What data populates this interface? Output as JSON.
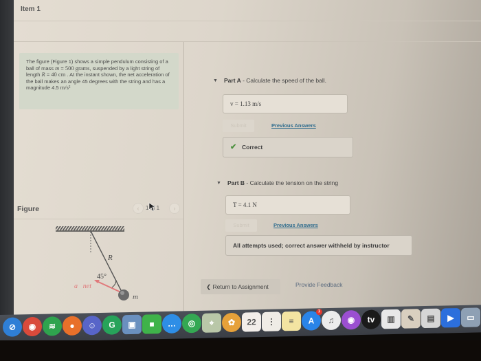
{
  "header": {
    "item_title": "Item 1"
  },
  "problem": {
    "text_parts": [
      "The figure (Figure 1) shows a simple pendulum consisting of a ball of mass ",
      "m",
      " = ",
      "500 grams",
      ", suspended by a light string of length ",
      "R",
      " = ",
      "40 cm",
      " . At the instant shown, the net acceleration of the ball makes an angle 45 degrees with the string and has a magnitude 4.5 ",
      "m/s²"
    ]
  },
  "figure": {
    "label": "Figure",
    "pager": {
      "prev": "‹",
      "count": "1 of 1",
      "next": "›"
    },
    "labels": {
      "length": "R",
      "angle": "45°",
      "accel": "a⃗net",
      "mass": "m"
    }
  },
  "partA": {
    "caret": "▼",
    "label": "Part A",
    "prompt": " - Calculate the speed of the ball.",
    "answer": "v =  1.13  m/s",
    "submit_label": "Submit",
    "previous_answers_label": "Previous Answers",
    "feedback_icon": "check-icon",
    "feedback_check": "✔",
    "feedback": "Correct",
    "feedback_color": "#4a8f3c"
  },
  "partB": {
    "caret": "▼",
    "label": "Part B",
    "prompt": " - Calculate the tension on the string",
    "answer": "T =  4.1  N",
    "submit_label": "Submit",
    "previous_answers_label": "Previous Answers",
    "feedback": "All attempts used; correct answer withheld by instructor"
  },
  "footer": {
    "return_label": "❮ Return to Assignment",
    "feedback_label": "Provide Feedback"
  },
  "dock": {
    "items": [
      {
        "name": "safari",
        "glyph": "⊘",
        "color": "#2f7fd6"
      },
      {
        "name": "chrome",
        "glyph": "◉",
        "color": "#d94a3b"
      },
      {
        "name": "spotify",
        "glyph": "≋",
        "color": "#2fa34e"
      },
      {
        "name": "firefox",
        "glyph": "●",
        "color": "#e8702a"
      },
      {
        "name": "discord",
        "glyph": "☺",
        "color": "#5865c8"
      },
      {
        "name": "grammarly",
        "glyph": "G",
        "color": "#27a35a"
      },
      {
        "name": "preview",
        "glyph": "▣",
        "color": "#6a90bf"
      },
      {
        "name": "facetime",
        "glyph": "■",
        "color": "#3fb34a"
      },
      {
        "name": "messages",
        "glyph": "…",
        "color": "#2e8ee6"
      },
      {
        "name": "find-my",
        "glyph": "◎",
        "color": "#34a853"
      },
      {
        "name": "maps",
        "glyph": "⌖",
        "color": "#b9c7a8"
      },
      {
        "name": "photos",
        "glyph": "✿",
        "color": "#e6a13a"
      },
      {
        "name": "calendar",
        "glyph": "22",
        "color": "#f2eeea"
      },
      {
        "name": "reminders",
        "glyph": "⋮",
        "color": "#efece6"
      },
      {
        "name": "notes",
        "glyph": "≡",
        "color": "#f3e4a2"
      },
      {
        "name": "app-store",
        "glyph": "A",
        "color": "#2a84e8",
        "badge": "1"
      },
      {
        "name": "music",
        "glyph": "♫",
        "color": "#ececec"
      },
      {
        "name": "podcasts",
        "glyph": "◉",
        "color": "#9b4fd1"
      },
      {
        "name": "apple-tv",
        "glyph": "tv",
        "color": "#1a1a1a"
      },
      {
        "name": "numbers",
        "glyph": "▥",
        "color": "#e8e8e8"
      },
      {
        "name": "pages",
        "glyph": "✎",
        "color": "#d9cfbf"
      },
      {
        "name": "keynote",
        "glyph": "▤",
        "color": "#d6d6d6"
      },
      {
        "name": "zoom",
        "glyph": "▶",
        "color": "#2c6fdc"
      },
      {
        "name": "screenshot-thumbnail",
        "glyph": "▭",
        "color": "#8ea0b4"
      }
    ]
  }
}
